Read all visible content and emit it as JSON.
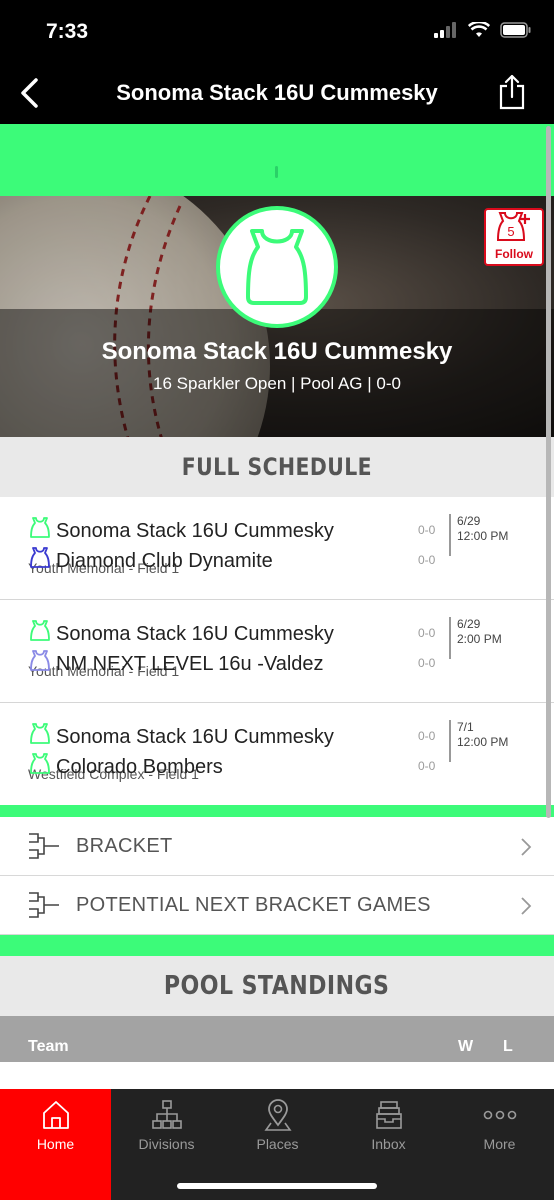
{
  "status_bar": {
    "time": "7:33"
  },
  "nav": {
    "title": "Sonoma Stack 16U Cummesky"
  },
  "hero": {
    "team_name": "Sonoma Stack 16U Cummesky",
    "subtitle": "16 Sparkler Open | Pool AG | 0-0",
    "follow_count": "5",
    "follow_label": "Follow"
  },
  "schedule": {
    "heading": "FULL SCHEDULE",
    "games": [
      {
        "team1": "Sonoma Stack 16U Cummesky",
        "team2": "Diamond Club Dynamite",
        "score1": "0-0",
        "score2": "0-0",
        "date": "6/29",
        "time": "12:00 PM",
        "venue": "Youth Memorial - Field 1",
        "team2_color": "#3a3ad0"
      },
      {
        "team1": "Sonoma Stack 16U Cummesky",
        "team2": "NM NEXT LEVEL 16u -Valdez",
        "score1": "0-0",
        "score2": "0-0",
        "date": "6/29",
        "time": "2:00 PM",
        "venue": "Youth Memorial - Field 1",
        "team2_color": "#8a8ae6"
      },
      {
        "team1": "Sonoma Stack 16U Cummesky",
        "team2": "Colorado Bombers",
        "score1": "0-0",
        "score2": "0-0",
        "date": "7/1",
        "time": "12:00 PM",
        "venue": "Westfield Complex - Field 1",
        "team2_color": "#3cfb79"
      }
    ]
  },
  "links": {
    "bracket": "BRACKET",
    "potential": "POTENTIAL NEXT BRACKET GAMES"
  },
  "standings": {
    "heading": "POOL STANDINGS",
    "col_team": "Team",
    "col_w": "W",
    "col_l": "L"
  },
  "tabs": [
    {
      "label": "Home",
      "icon": "home-icon",
      "active": true
    },
    {
      "label": "Divisions",
      "icon": "divisions-icon",
      "active": false
    },
    {
      "label": "Places",
      "icon": "map-pin-icon",
      "active": false
    },
    {
      "label": "Inbox",
      "icon": "inbox-icon",
      "active": false
    },
    {
      "label": "More",
      "icon": "more-icon",
      "active": false
    }
  ],
  "colors": {
    "accent_green": "#3cfb79",
    "brand_red": "#ff0000",
    "follow_red": "#d90b1c"
  }
}
